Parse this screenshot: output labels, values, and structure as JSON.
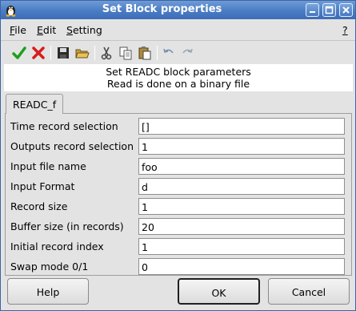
{
  "window": {
    "title": "Set Block properties",
    "colors": {
      "titlebar": "#4a7cc4",
      "background": "#e3e3e3",
      "ok_green": "#1ba01b",
      "cancel_red": "#d81c1c"
    }
  },
  "menubar": {
    "items": [
      {
        "accel": "F",
        "rest": "ile"
      },
      {
        "accel": "E",
        "rest": "dit"
      },
      {
        "accel": "S",
        "rest": "etting"
      }
    ],
    "help": "?"
  },
  "toolbar": {
    "icons": [
      "check-icon",
      "cross-icon",
      "save-icon",
      "open-folder-icon",
      "cut-icon",
      "copy-icon",
      "paste-icon",
      "undo-icon",
      "redo-icon"
    ]
  },
  "description": {
    "line1": "Set READC block parameters",
    "line2": "Read is done on a binary file"
  },
  "tab": {
    "label": "READC_f"
  },
  "fields": [
    {
      "label": "Time record selection",
      "value": "[]"
    },
    {
      "label": "Outputs record selection",
      "value": "1"
    },
    {
      "label": "Input file name",
      "value": "foo"
    },
    {
      "label": "Input Format",
      "value": "d"
    },
    {
      "label": "Record size",
      "value": "1"
    },
    {
      "label": "Buffer size (in records)",
      "value": "20"
    },
    {
      "label": "Initial record index",
      "value": "1"
    },
    {
      "label": "Swap mode 0/1",
      "value": "0"
    }
  ],
  "buttons": {
    "help": "Help",
    "ok": "OK",
    "cancel": "Cancel"
  }
}
